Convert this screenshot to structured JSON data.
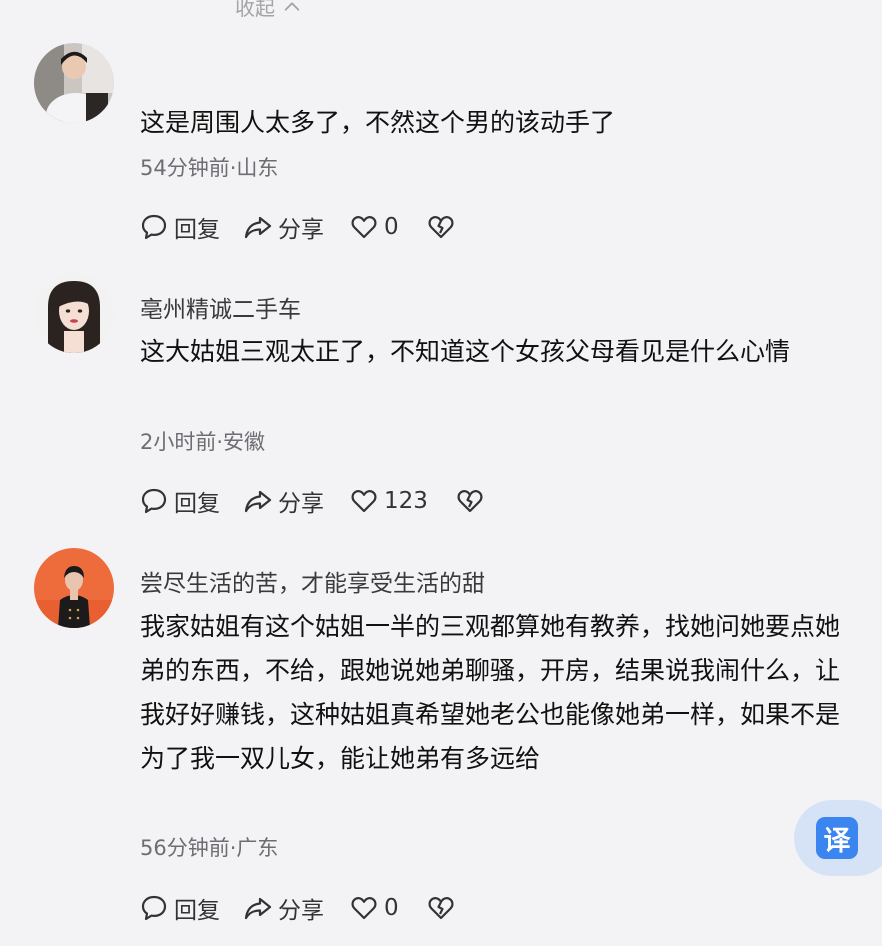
{
  "top": {
    "collapse_label": "收起"
  },
  "comments": [
    {
      "username": "",
      "text": "这是周围人太多了，不然这个男的该动手了",
      "meta": "54分钟前·山东",
      "reply_label": "回复",
      "share_label": "分享",
      "like_count": "0"
    },
    {
      "username": "亳州精诚二手车",
      "text": "这大姑姐三观太正了，不知道这个女孩父母看见是什么心情",
      "meta": "2小时前·安徽",
      "reply_label": "回复",
      "share_label": "分享",
      "like_count": "123"
    },
    {
      "username": "尝尽生活的苦，才能享受生活的甜",
      "text": "我家姑姐有这个姑姐一半的三观都算她有教养，找她问她要点她弟的东西，不给，跟她说她弟聊骚，开房，结果说我闹什么，让我好好赚钱，这种姑姐真希望她老公也能像她弟一样，如果不是为了我一双儿女，能让她弟有多远给",
      "meta": "56分钟前·广东",
      "reply_label": "回复",
      "share_label": "分享",
      "like_count": "0"
    }
  ],
  "translate": {
    "label": "译"
  },
  "colors": {
    "background": "#f3f3f5",
    "translate_accent": "#3a85f0",
    "translate_bg": "#d6e3f6"
  }
}
